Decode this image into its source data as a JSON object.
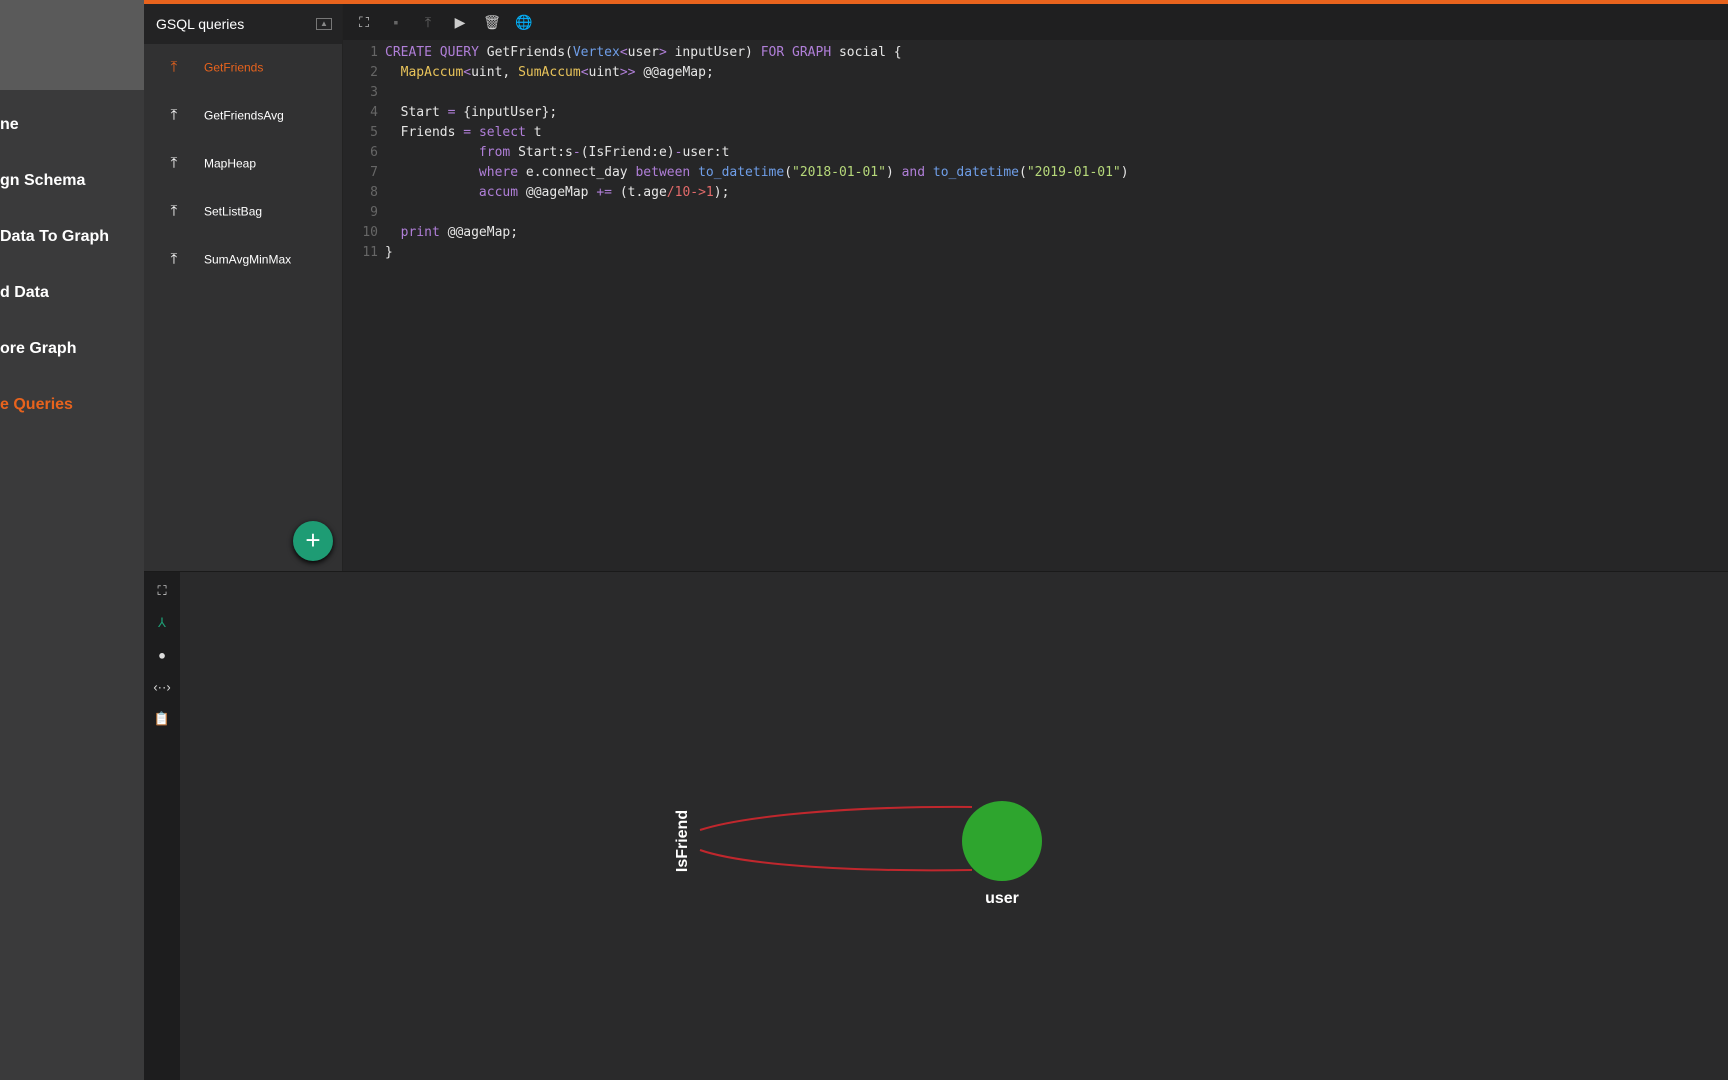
{
  "nav": {
    "items": [
      {
        "label": "ne"
      },
      {
        "label": "gn Schema"
      },
      {
        "label": " Data To Graph"
      },
      {
        "label": "d Data"
      },
      {
        "label": "ore Graph"
      },
      {
        "label": "e Queries",
        "active": true
      }
    ]
  },
  "queries": {
    "title": "GSQL queries",
    "items": [
      {
        "label": "GetFriends",
        "active": true
      },
      {
        "label": "GetFriendsAvg"
      },
      {
        "label": "MapHeap"
      },
      {
        "label": "SetListBag"
      },
      {
        "label": "SumAvgMinMax"
      }
    ],
    "add_label": "+"
  },
  "toolbar": [
    "expand-icon",
    "save-icon",
    "install-icon",
    "run-icon",
    "delete-icon",
    "globe-icon"
  ],
  "code": {
    "lines": [
      [
        [
          "kw",
          "CREATE QUERY "
        ],
        [
          "pl",
          "GetFriends("
        ],
        [
          "fn",
          "Vertex"
        ],
        [
          "op",
          "<"
        ],
        [
          "pl",
          "user"
        ],
        [
          "op",
          "> "
        ],
        [
          "pl",
          "inputUser) "
        ],
        [
          "kw",
          "FOR GRAPH "
        ],
        [
          "pl",
          "social {"
        ]
      ],
      [
        [
          "pl",
          "  "
        ],
        [
          "ty",
          "MapAccum"
        ],
        [
          "op",
          "<"
        ],
        [
          "pl",
          "uint, "
        ],
        [
          "ty",
          "SumAccum"
        ],
        [
          "op",
          "<"
        ],
        [
          "pl",
          "uint"
        ],
        [
          "op",
          ">> "
        ],
        [
          "pl",
          "@@ageMap;"
        ]
      ],
      [],
      [
        [
          "pl",
          "  Start "
        ],
        [
          "op",
          "= "
        ],
        [
          "pl",
          "{inputUser};"
        ]
      ],
      [
        [
          "pl",
          "  Friends "
        ],
        [
          "op",
          "= "
        ],
        [
          "kw",
          "select "
        ],
        [
          "pl",
          "t"
        ]
      ],
      [
        [
          "pl",
          "            "
        ],
        [
          "kw",
          "from "
        ],
        [
          "pl",
          "Start:s"
        ],
        [
          "op",
          "-"
        ],
        [
          "pl",
          "(IsFriend:e)"
        ],
        [
          "op",
          "-"
        ],
        [
          "pl",
          "user:t"
        ]
      ],
      [
        [
          "pl",
          "            "
        ],
        [
          "kw",
          "where "
        ],
        [
          "pl",
          "e.connect_day "
        ],
        [
          "kw",
          "between "
        ],
        [
          "fn",
          "to_datetime"
        ],
        [
          "pl",
          "("
        ],
        [
          "st",
          "\"2018-01-01\""
        ],
        [
          "pl",
          ") "
        ],
        [
          "kw",
          "and "
        ],
        [
          "fn",
          "to_datetime"
        ],
        [
          "pl",
          "("
        ],
        [
          "st",
          "\"2019-01-01\""
        ],
        [
          "pl",
          ")"
        ]
      ],
      [
        [
          "pl",
          "            "
        ],
        [
          "kw",
          "accum "
        ],
        [
          "pl",
          "@@ageMap "
        ],
        [
          "op",
          "+= "
        ],
        [
          "pl",
          "(t.age"
        ],
        [
          "nm",
          "/10->1"
        ],
        [
          "pl",
          ");"
        ]
      ],
      [],
      [
        [
          "pl",
          "  "
        ],
        [
          "kw",
          "print "
        ],
        [
          "pl",
          "@@ageMap;"
        ]
      ],
      [
        [
          "pl",
          "}"
        ]
      ]
    ]
  },
  "side_tools": [
    "fit-screen-icon",
    "graph-layout-icon",
    "bubbles-icon",
    "code-icon",
    "clipboard-icon"
  ],
  "graph": {
    "vertex": {
      "label": "user",
      "color": "#2ea52e"
    },
    "edge": {
      "label": "IsFriend",
      "color": "#c0272d"
    }
  },
  "colors": {
    "accent": "#e8631d",
    "add": "#1e9c74"
  }
}
